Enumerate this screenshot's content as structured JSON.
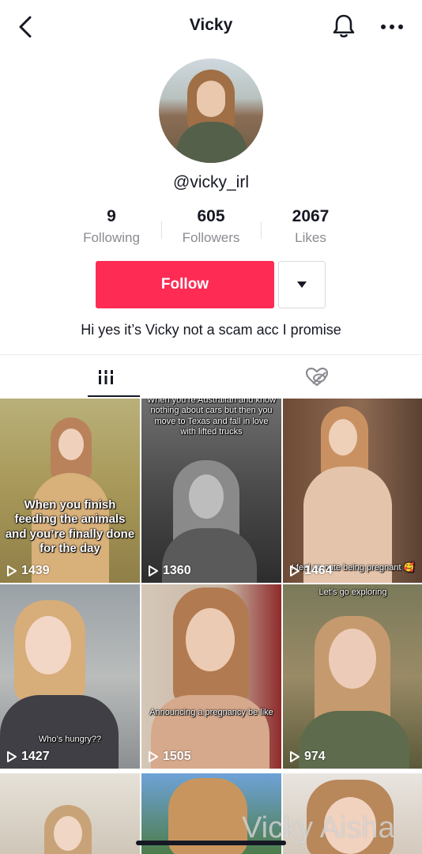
{
  "header": {
    "title": "Vicky"
  },
  "profile": {
    "handle": "@vicky_irl",
    "bio": "Hi yes it’s Vicky not a scam acc I promise",
    "stats": [
      {
        "value": "9",
        "label": "Following"
      },
      {
        "value": "605",
        "label": "Followers"
      },
      {
        "value": "2067",
        "label": "Likes"
      }
    ],
    "follow_label": "Follow"
  },
  "colors": {
    "accent": "#fe2c55",
    "text": "#161823",
    "muted": "#8a8b91"
  },
  "icons": {
    "back": "chevron-left-icon",
    "bell": "bell-icon",
    "more": "more-dots-icon",
    "dropdown": "caret-down-icon",
    "videos_tab": "grid-bars-icon",
    "liked_tab": "heart-hidden-icon",
    "play": "play-icon"
  },
  "videos": [
    {
      "caption": "When you finish feeding the animals and you’re finally done for the day",
      "views": "1439"
    },
    {
      "caption": "When you’re Australian and know nothing about cars but then you move to Texas and fall in love with lifted trucks",
      "views": "1360"
    },
    {
      "caption": "I feel so cute being pregnant 🥰",
      "views": "1464"
    },
    {
      "caption": "Who’s hungry??",
      "views": "1427"
    },
    {
      "caption": "Announcing a pregnancy be like",
      "views": "1505"
    },
    {
      "caption": "Let’s go exploring",
      "views": "974"
    },
    {
      "caption": "",
      "views": ""
    },
    {
      "caption": "",
      "views": ""
    },
    {
      "caption": "",
      "views": ""
    }
  ],
  "watermark": "Vicky Aisha"
}
